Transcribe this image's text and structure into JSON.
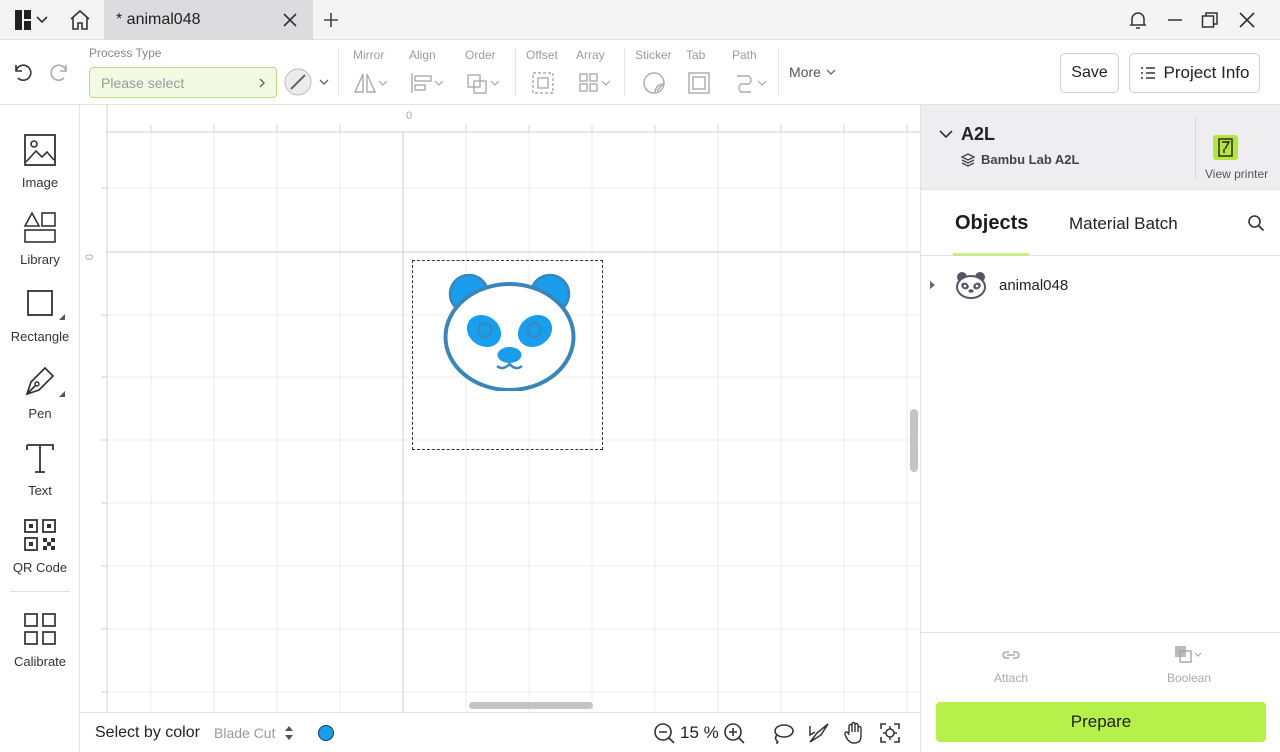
{
  "titlebar": {
    "tab_label": "* animal048"
  },
  "toolbar": {
    "process_type_label": "Process Type",
    "process_placeholder": "Please select",
    "groups": {
      "mirror": "Mirror",
      "align": "Align",
      "order": "Order",
      "offset": "Offset",
      "array": "Array",
      "sticker": "Sticker",
      "tab": "Tab",
      "path": "Path"
    },
    "more_label": "More",
    "save_label": "Save",
    "project_info_label": "Project Info"
  },
  "left_tools": [
    {
      "label": "Image",
      "icon": "image-icon"
    },
    {
      "label": "Library",
      "icon": "library-icon"
    },
    {
      "label": "Rectangle",
      "icon": "rectangle-icon"
    },
    {
      "label": "Pen",
      "icon": "pen-icon"
    },
    {
      "label": "Text",
      "icon": "text-icon"
    },
    {
      "label": "QR Code",
      "icon": "qr-code-icon"
    },
    {
      "label": "Calibrate",
      "icon": "calibrate-icon"
    }
  ],
  "canvas": {
    "ruler_origin_x": "0",
    "ruler_origin_y": "0",
    "object_fill_color": "#1a9dec",
    "object_outline_color": "#3a86b8"
  },
  "bottombar": {
    "select_by_color_label": "Select by color",
    "blade_label": "Blade Cut",
    "zoom_level": "15 %",
    "color_swatch": "#1a9dec"
  },
  "right_panel": {
    "printer_name": "A2L",
    "printer_model": "Bambu Lab A2L",
    "view_printer_label": "View printer",
    "tabs": {
      "objects": "Objects",
      "material_batch": "Material Batch"
    },
    "objects": [
      {
        "name": "animal048",
        "icon": "panda-icon"
      }
    ],
    "attach_label": "Attach",
    "boolean_label": "Boolean",
    "prepare_label": "Prepare",
    "accent_color": "#b6f04a"
  }
}
